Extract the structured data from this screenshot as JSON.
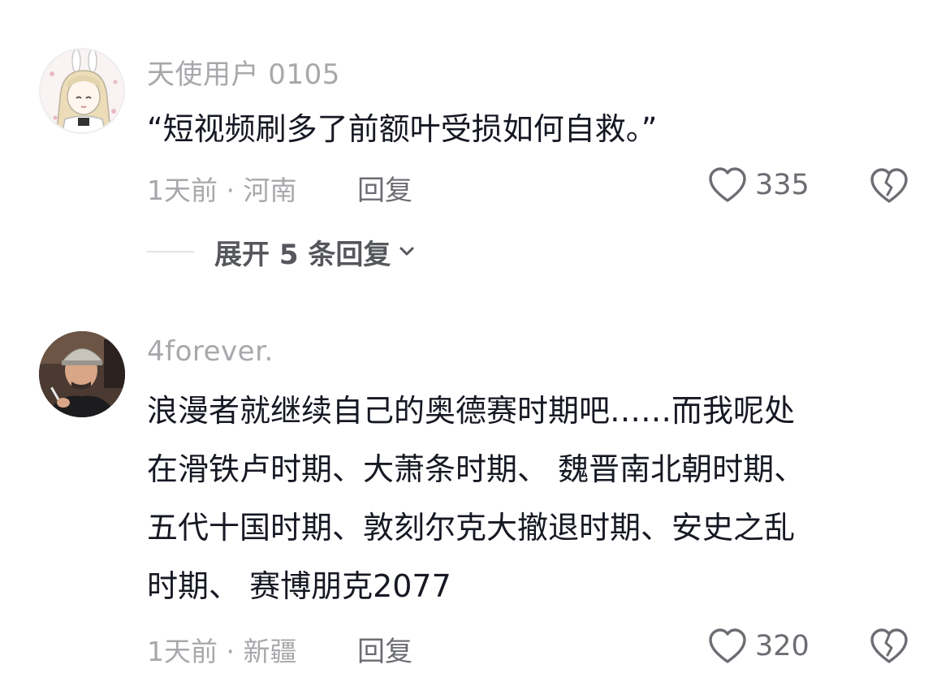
{
  "comments": [
    {
      "username": "天使用户 0105",
      "avatar_icon": "anime-girl-avatar",
      "lines": [
        "“短视频刷多了前额叶受损如何自救。”"
      ],
      "meta": "1天前 · 河南",
      "reply_label": "回复",
      "like_count": "335",
      "expand_label": "展开 5 条回复"
    },
    {
      "username": "4forever.",
      "avatar_icon": "man-in-cap-avatar",
      "lines": [
        "浪漫者就继续自己的奥德赛时期吧……而我呢处",
        "在滑铁卢时期、大萧条时期、 魏晋南北朝时期、",
        "五代十国时期、敦刻尔克大撤退时期、安史之乱",
        "时期、 赛博朋克2077"
      ],
      "meta": "1天前 · 新疆",
      "reply_label": "回复",
      "like_count": "320"
    }
  ],
  "icons": {
    "like": "heart-outline-icon",
    "dislike": "broken-heart-icon",
    "expand": "chevron-down-icon"
  },
  "colors": {
    "text": "#161823",
    "secondary": "#a7a8ab",
    "action": "#6b6d72"
  }
}
